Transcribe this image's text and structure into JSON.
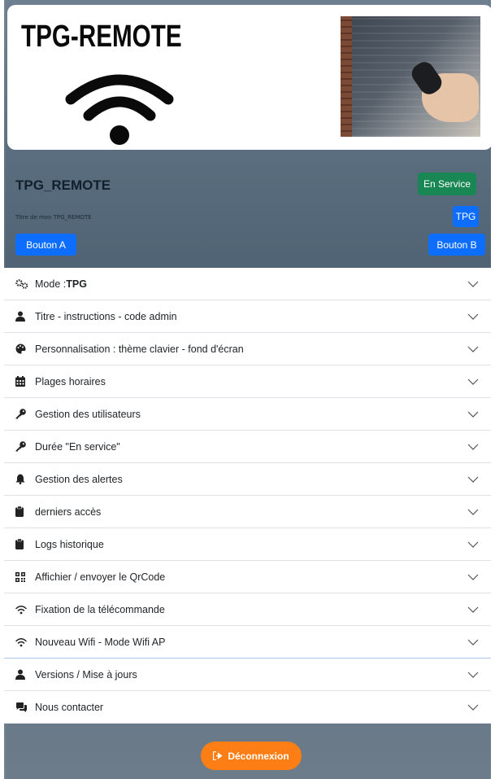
{
  "banner": {
    "title": "TPG-REMOTE"
  },
  "device": {
    "name": "TPG_REMOTE",
    "subtitle": "Titre de mon TPG_REMOTE",
    "status_button": "En Service",
    "mode_button": "TPG",
    "button_a": "Bouton A",
    "button_b": "Bouton B"
  },
  "accordion": {
    "items": [
      {
        "icon": "gears-icon",
        "label": "Mode :",
        "bold": "TPG"
      },
      {
        "icon": "user-icon",
        "label": "Titre - instructions - code admin"
      },
      {
        "icon": "palette-icon",
        "label": "Personnalisation : thème clavier - fond d'écran"
      },
      {
        "icon": "calendar-icon",
        "label": "Plages horaires"
      },
      {
        "icon": "key-icon",
        "label": "Gestion des utilisateurs"
      },
      {
        "icon": "key-icon",
        "label": "Durée \"En service\""
      },
      {
        "icon": "bell-icon",
        "label": "Gestion des alertes"
      },
      {
        "icon": "clipboard-icon",
        "label": "derniers accès"
      },
      {
        "icon": "clipboard-icon",
        "label": "Logs historique"
      },
      {
        "icon": "qrcode-icon",
        "label": "Affichier / envoyer le QrCode"
      },
      {
        "icon": "wifi-icon",
        "label": "Fixation de la télécommande"
      },
      {
        "icon": "wifi-icon",
        "label": "Nouveau Wifi - Mode Wifi AP"
      },
      {
        "icon": "user-icon",
        "label": "Versions / Mise à jours"
      },
      {
        "icon": "comments-icon",
        "label": "Nous contacter"
      }
    ]
  },
  "footer": {
    "logout_label": "Déconnexion"
  },
  "colors": {
    "green": "#198754",
    "blue": "#0d6efd",
    "orange": "#fd7e14"
  }
}
